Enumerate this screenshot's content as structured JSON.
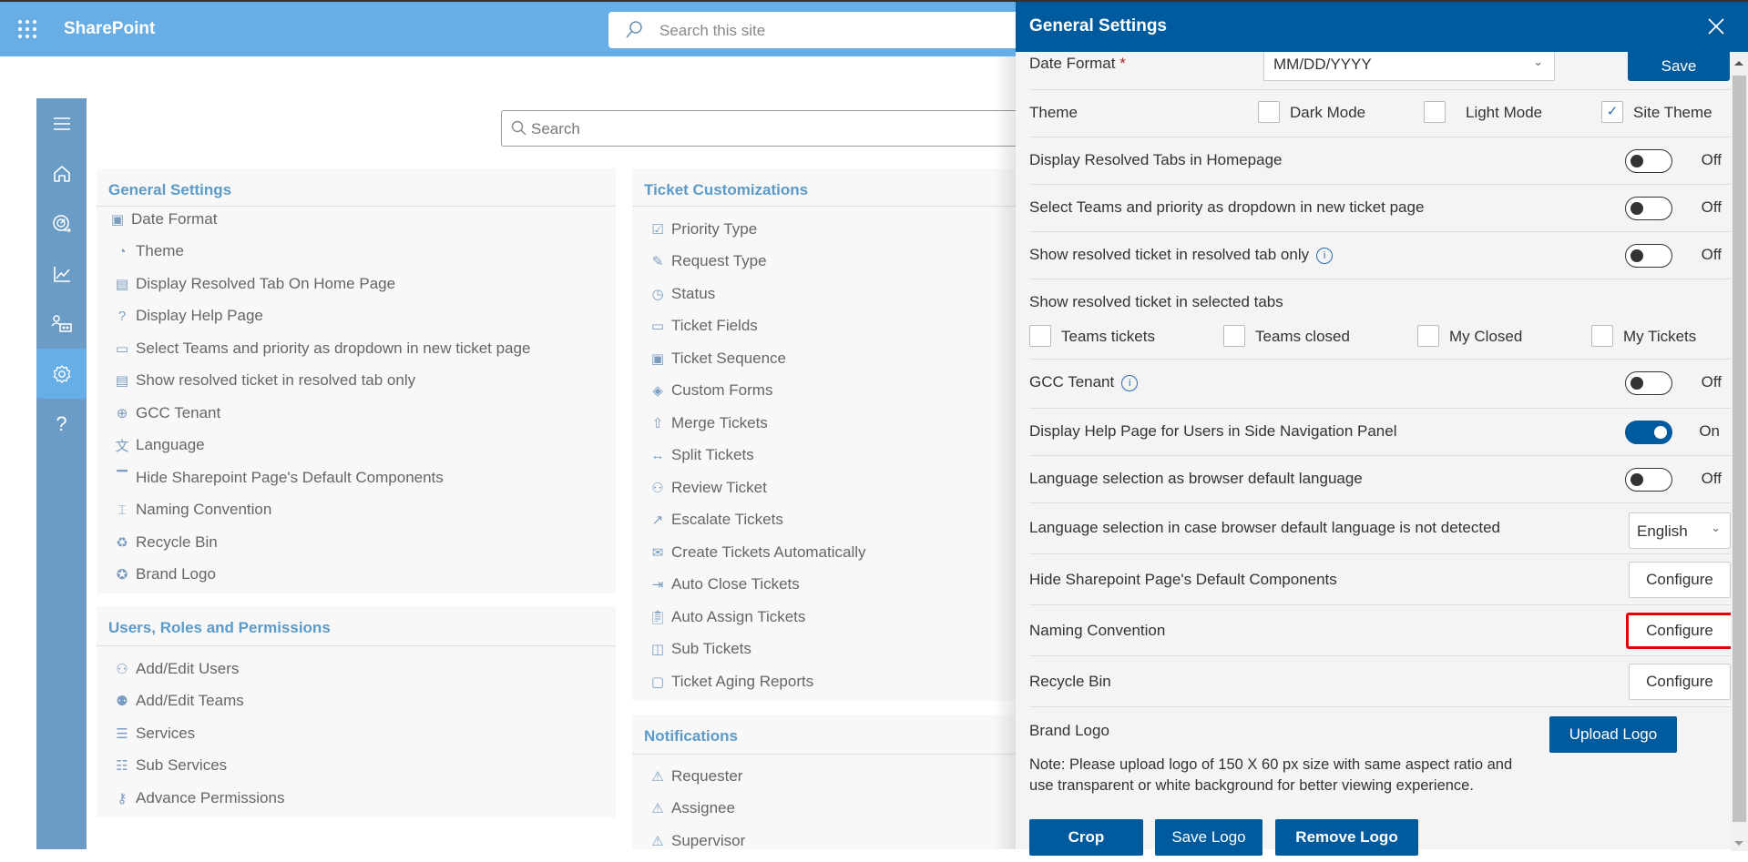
{
  "topbar": {
    "app_name": "SharePoint",
    "search_placeholder": "Search this site"
  },
  "main_search": {
    "placeholder": "Search"
  },
  "left_nav": [
    {
      "icon": "hamburger-icon"
    },
    {
      "icon": "home-icon"
    },
    {
      "icon": "dashboard-icon"
    },
    {
      "icon": "chart-icon"
    },
    {
      "icon": "users-icon"
    },
    {
      "icon": "gear-icon",
      "active": true
    },
    {
      "icon": "help-icon"
    }
  ],
  "cards": {
    "general": {
      "title": "General Settings",
      "items": [
        "Date Format",
        "Theme",
        "Display Resolved Tab On Home Page",
        "Display Help Page",
        "Select Teams and priority as dropdown in new ticket page",
        "Show resolved ticket in resolved tab only",
        "GCC Tenant",
        "Language",
        "Hide Sharepoint Page's Default Components",
        "Naming Convention",
        "Recycle Bin",
        "Brand Logo"
      ]
    },
    "users": {
      "title": "Users, Roles and Permissions",
      "items": [
        "Add/Edit Users",
        "Add/Edit Teams",
        "Services",
        "Sub Services",
        "Advance Permissions"
      ]
    },
    "ticket": {
      "title": "Ticket Customizations",
      "items": [
        "Priority Type",
        "Request Type",
        "Status",
        "Ticket Fields",
        "Ticket Sequence",
        "Custom Forms",
        "Merge Tickets",
        "Split Tickets",
        "Review Ticket",
        "Escalate Tickets",
        "Create Tickets Automatically",
        "Auto Close Tickets",
        "Auto Assign Tickets",
        "Sub Tickets",
        "Ticket Aging Reports"
      ]
    },
    "notifications": {
      "title": "Notifications",
      "items": [
        "Requester",
        "Assignee",
        "Supervisor"
      ]
    }
  },
  "panel": {
    "title": "General Settings",
    "save_label": "Save",
    "date_format": {
      "label": "Date Format",
      "required_mark": "*",
      "value": "MM/DD/YYYY"
    },
    "theme": {
      "label": "Theme",
      "options": [
        {
          "label": "Dark Mode",
          "checked": false
        },
        {
          "label": "Light Mode",
          "checked": false
        },
        {
          "label": "Site Theme",
          "checked": true
        }
      ]
    },
    "toggles": [
      {
        "label": "Display Resolved Tabs in Homepage",
        "state": "Off"
      },
      {
        "label": "Select Teams and priority as dropdown in new ticket page",
        "state": "Off"
      },
      {
        "label": "Show resolved ticket in resolved tab only",
        "state": "Off",
        "info": true
      }
    ],
    "resolved_tabs": {
      "label": "Show resolved ticket in selected tabs",
      "options": [
        {
          "label": "Teams tickets",
          "checked": false
        },
        {
          "label": "Teams closed",
          "checked": false
        },
        {
          "label": "My Closed",
          "checked": false
        },
        {
          "label": "My Tickets",
          "checked": false
        }
      ]
    },
    "gcc": {
      "label": "GCC Tenant",
      "state": "Off"
    },
    "help_page": {
      "label": "Display Help Page for Users in Side Navigation Panel",
      "state": "On"
    },
    "lang_browser": {
      "label": "Language selection as browser default language",
      "state": "Off"
    },
    "lang_fallback": {
      "label": "Language selection in case browser default language is not detected",
      "value": "English"
    },
    "configure_rows": [
      {
        "label": "Hide Sharepoint Page's Default Components",
        "button": "Configure"
      },
      {
        "label": "Naming Convention",
        "button": "Configure",
        "highlighted": true
      },
      {
        "label": "Recycle Bin",
        "button": "Configure"
      }
    ],
    "brand_logo": {
      "label": "Brand Logo",
      "upload_label": "Upload Logo",
      "note": "Note: Please upload logo of 150 X 60 px size with same aspect ratio and use transparent or white background for better viewing experience.",
      "crop_label": "Crop",
      "save_logo_label": "Save Logo",
      "remove_logo_label": "Remove Logo"
    }
  },
  "colors": {
    "topbar": "#67ade6",
    "nav": "#6a9cc6",
    "panel_header": "#005a9e",
    "accent_link": "#5b9ac9",
    "highlight": "#e00000"
  }
}
